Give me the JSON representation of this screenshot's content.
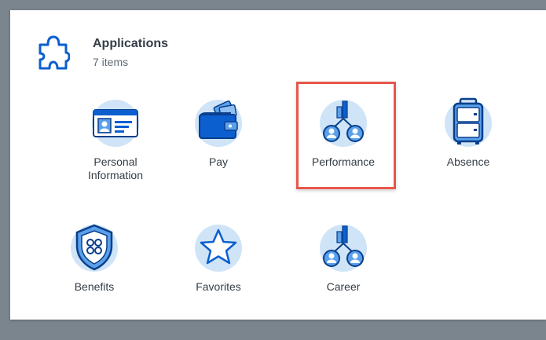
{
  "header": {
    "title": "Applications",
    "count": "7 items",
    "icon": "puzzle-icon"
  },
  "apps": [
    {
      "label": "Personal Information",
      "icon": "id-card-icon"
    },
    {
      "label": "Pay",
      "icon": "wallet-icon"
    },
    {
      "label": "Performance",
      "icon": "performance-chart-icon",
      "highlighted": true
    },
    {
      "label": "Absence",
      "icon": "suitcase-icon"
    },
    {
      "label": "Benefits",
      "icon": "shield-icon"
    },
    {
      "label": "Favorites",
      "icon": "star-icon"
    },
    {
      "label": "Career",
      "icon": "career-chart-icon"
    }
  ],
  "colors": {
    "icon_circle": "#cfe4f7",
    "icon_blue": "#0b5fcf",
    "icon_dark": "#0a3f8c",
    "highlight_border": "#e8574b"
  }
}
